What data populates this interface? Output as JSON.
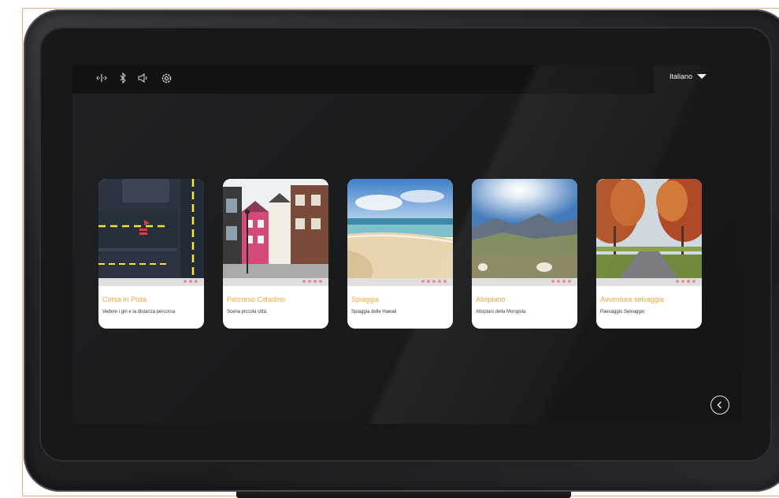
{
  "statusbar": {
    "icons": [
      "network-icon",
      "bluetooth-icon",
      "volume-icon",
      "settings-icon"
    ],
    "language": "Italiano"
  },
  "scenes": [
    {
      "title": "Corsa in Pista",
      "subtitle": "Vedere i giri e la distanza percorsa"
    },
    {
      "title": "Percorso Cittadino",
      "subtitle": "Scena piccola città"
    },
    {
      "title": "Spiaggia",
      "subtitle": "Spiaggia delle Hawaii"
    },
    {
      "title": "Altopiano",
      "subtitle": "Altopiani della Mongolia"
    },
    {
      "title": "Avventura selvaggia",
      "subtitle": "Paesaggio Selvaggio"
    }
  ],
  "colors": {
    "accent": "#f0a63a",
    "dots": "#e88aa0",
    "screen": "#1c1d1f"
  }
}
